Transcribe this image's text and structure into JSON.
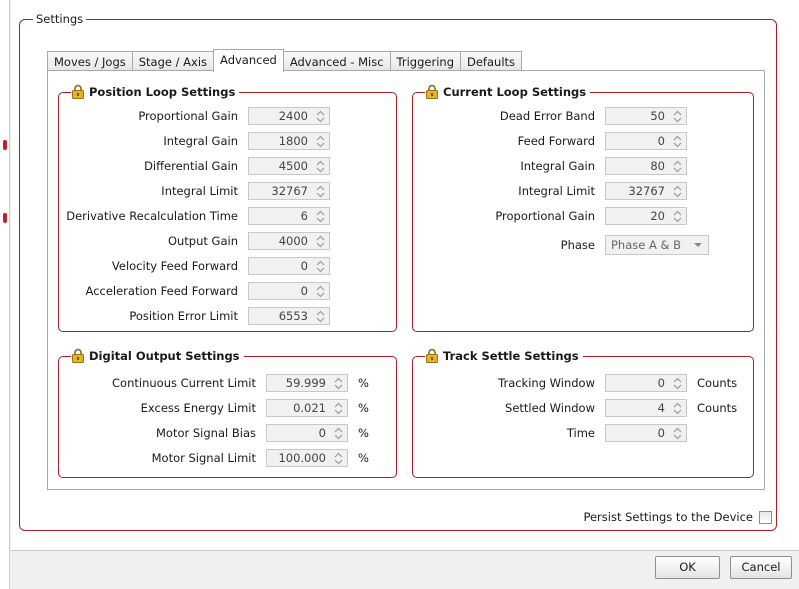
{
  "settings_group": {
    "title": "Settings"
  },
  "tabs": [
    {
      "label": "Moves / Jogs"
    },
    {
      "label": "Stage / Axis"
    },
    {
      "label": "Advanced",
      "active": true
    },
    {
      "label": "Advanced - Misc"
    },
    {
      "label": "Triggering"
    },
    {
      "label": "Defaults"
    }
  ],
  "position_loop": {
    "title": "Position Loop Settings",
    "fields": [
      {
        "label": "Proportional Gain",
        "value": "2400"
      },
      {
        "label": "Integral Gain",
        "value": "1800"
      },
      {
        "label": "Differential Gain",
        "value": "4500"
      },
      {
        "label": "Integral Limit",
        "value": "32767"
      },
      {
        "label": "Derivative Recalculation Time",
        "value": "6"
      },
      {
        "label": "Output Gain",
        "value": "4000"
      },
      {
        "label": "Velocity Feed Forward",
        "value": "0"
      },
      {
        "label": "Acceleration Feed Forward",
        "value": "0"
      },
      {
        "label": "Position Error Limit",
        "value": "6553"
      }
    ]
  },
  "current_loop": {
    "title": "Current Loop Settings",
    "fields": [
      {
        "label": "Dead Error Band",
        "value": "50"
      },
      {
        "label": "Feed Forward",
        "value": "0"
      },
      {
        "label": "Integral Gain",
        "value": "80"
      },
      {
        "label": "Integral Limit",
        "value": "32767"
      },
      {
        "label": "Proportional Gain",
        "value": "20"
      }
    ],
    "phase": {
      "label": "Phase",
      "value": "Phase A & B"
    }
  },
  "digital_output": {
    "title": "Digital Output Settings",
    "fields": [
      {
        "label": "Continuous Current Limit",
        "value": "59.999",
        "unit": "%"
      },
      {
        "label": "Excess Energy Limit",
        "value": "0.021",
        "unit": "%"
      },
      {
        "label": "Motor Signal Bias",
        "value": "0",
        "unit": "%"
      },
      {
        "label": "Motor Signal Limit",
        "value": "100.000",
        "unit": "%"
      }
    ]
  },
  "track_settle": {
    "title": "Track Settle Settings",
    "fields": [
      {
        "label": "Tracking Window",
        "value": "0",
        "unit": "Counts"
      },
      {
        "label": "Settled Window",
        "value": "4",
        "unit": "Counts"
      },
      {
        "label": "Time",
        "value": "0",
        "unit": ""
      }
    ]
  },
  "persist": {
    "label": "Persist Settings to the Device",
    "checked": false
  },
  "buttons": {
    "ok": "OK",
    "cancel": "Cancel"
  },
  "colors": {
    "accent": "#b01c26",
    "lock": "#d9a21b",
    "disabled_field": "#f1f1f1"
  },
  "icons": {
    "lock": "lock-icon",
    "spin_arrows": "spin-arrows-icon",
    "dropdown": "chevron-down-icon"
  }
}
